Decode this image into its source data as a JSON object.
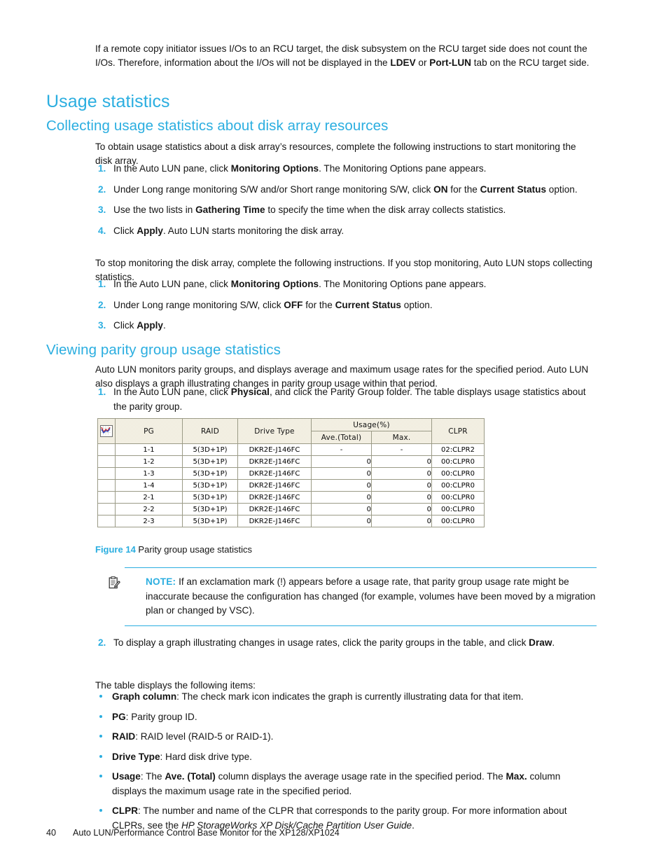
{
  "intro": {
    "part1": "If a remote copy initiator issues I/Os to an RCU target, the disk subsystem on the RCU target side does not count the I/Os. Therefore, information about the I/Os will not be displayed in the ",
    "bold1": "LDEV",
    "mid1": " or ",
    "bold2": "Port-LUN",
    "part2": " tab on the RCU target side."
  },
  "headings": {
    "h1_usage_statistics": "Usage statistics",
    "h2_collecting": "Collecting usage statistics about disk array resources",
    "h2_viewing": "Viewing parity group usage statistics"
  },
  "collecting": {
    "lead": "To obtain usage statistics about a disk array’s resources, complete the following instructions to start monitoring the disk array.",
    "steps": [
      {
        "num": "1.",
        "pre": "In the Auto LUN pane, click ",
        "bold": "Monitoring Options",
        "post": ". The Monitoring Options pane appears."
      },
      {
        "num": "2.",
        "pre": "Under Long range monitoring S/W and/or Short range monitoring S/W, click ",
        "bold": "ON",
        "mid": " for the ",
        "bold2": "Current Status",
        "post": " option."
      },
      {
        "num": "3.",
        "pre": "Use the two lists in ",
        "bold": "Gathering Time",
        "post": " to specify the time when the disk array collects statistics."
      },
      {
        "num": "4.",
        "pre": "Click ",
        "bold": "Apply",
        "post": ". Auto LUN starts monitoring the disk array."
      }
    ],
    "stop_lead": "To stop monitoring the disk array, complete the following instructions. If you stop monitoring, Auto LUN stops collecting statistics.",
    "stop_steps": [
      {
        "num": "1.",
        "pre": "In the Auto LUN pane, click ",
        "bold": "Monitoring Options",
        "post": ". The Monitoring Options pane appears."
      },
      {
        "num": "2.",
        "pre": "Under Long range monitoring S/W, click ",
        "bold": "OFF",
        "mid": " for the ",
        "bold2": "Current Status",
        "post": " option."
      },
      {
        "num": "3.",
        "pre": "Click ",
        "bold": "Apply",
        "post": "."
      }
    ]
  },
  "viewing": {
    "lead": "Auto LUN monitors parity groups, and displays average and maximum usage rates for the specified period. Auto LUN also displays a graph illustrating changes in parity group usage within that period.",
    "step1": {
      "num": "1.",
      "pre": "In the Auto LUN pane, click ",
      "bold": "Physical",
      "post": ", and click the Parity Group folder. The table displays usage statistics about the parity group."
    },
    "step2": {
      "num": "2.",
      "pre": "To display a graph illustrating changes in usage rates, click the parity groups in the table, and click ",
      "bold": "Draw",
      "post": "."
    },
    "items_lead": "The table displays the following items:"
  },
  "figure": {
    "label": "Figure 14",
    "caption": "Parity group usage statistics"
  },
  "table": {
    "graph_icon_name": "graph-column-icon",
    "headers": {
      "graph": "",
      "pg": "PG",
      "raid": "RAID",
      "drive_type": "Drive Type",
      "usage_group": "Usage(%)",
      "ave_total": "Ave.(Total)",
      "max": "Max.",
      "clpr": "CLPR"
    },
    "rows": [
      {
        "graph": "",
        "pg": "1-1",
        "raid": "5(3D+1P)",
        "drive": "DKR2E-J146FC",
        "ave": "-",
        "max": "-",
        "clpr": "02:CLPR2"
      },
      {
        "graph": "",
        "pg": "1-2",
        "raid": "5(3D+1P)",
        "drive": "DKR2E-J146FC",
        "ave": "0",
        "max": "0",
        "clpr": "00:CLPR0"
      },
      {
        "graph": "",
        "pg": "1-3",
        "raid": "5(3D+1P)",
        "drive": "DKR2E-J146FC",
        "ave": "0",
        "max": "0",
        "clpr": "00:CLPR0"
      },
      {
        "graph": "",
        "pg": "1-4",
        "raid": "5(3D+1P)",
        "drive": "DKR2E-J146FC",
        "ave": "0",
        "max": "0",
        "clpr": "00:CLPR0"
      },
      {
        "graph": "",
        "pg": "2-1",
        "raid": "5(3D+1P)",
        "drive": "DKR2E-J146FC",
        "ave": "0",
        "max": "0",
        "clpr": "00:CLPR0"
      },
      {
        "graph": "",
        "pg": "2-2",
        "raid": "5(3D+1P)",
        "drive": "DKR2E-J146FC",
        "ave": "0",
        "max": "0",
        "clpr": "00:CLPR0"
      },
      {
        "graph": "",
        "pg": "2-3",
        "raid": "5(3D+1P)",
        "drive": "DKR2E-J146FC",
        "ave": "0",
        "max": "0",
        "clpr": "00:CLPR0"
      }
    ]
  },
  "note": {
    "label": "NOTE:",
    "icon_name": "note-clipboard-icon",
    "text": "If an exclamation mark (!) appears before a usage rate, that parity group usage rate might be inaccurate because the configuration has changed (for example, volumes have been moved by a migration plan or changed by VSC)."
  },
  "bullets": [
    {
      "bold": "Graph column",
      "text": ": The check mark icon indicates the graph is currently illustrating data for that item."
    },
    {
      "bold": "PG",
      "text": ": Parity group ID."
    },
    {
      "bold": "RAID",
      "text": ": RAID level (RAID-5 or RAID-1)."
    },
    {
      "bold": "Drive Type",
      "text": ": Hard disk drive type."
    },
    {
      "bold": "Usage",
      "pre": ": The ",
      "bold2": "Ave. (Total)",
      "mid": " column displays the average usage rate in the specified period. The ",
      "bold3": "Max.",
      "post": " column displays the maximum usage rate in the specified period."
    },
    {
      "bold": "CLPR",
      "pre": ": The number and name of the CLPR that corresponds to the parity group. For more information about CLPRs, see the ",
      "italic": "HP StorageWorks XP Disk/Cache Partition User Guide",
      "post": "."
    }
  ],
  "footer": {
    "page_number": "40",
    "title": "Auto LUN/Performance Control Base Monitor for the XP128/XP1024"
  },
  "colors": {
    "heading_blue": "#2BAEE0",
    "body_text": "#151515",
    "table_header_bg": "#e8e2cc",
    "table_border": "#9b9b87"
  }
}
